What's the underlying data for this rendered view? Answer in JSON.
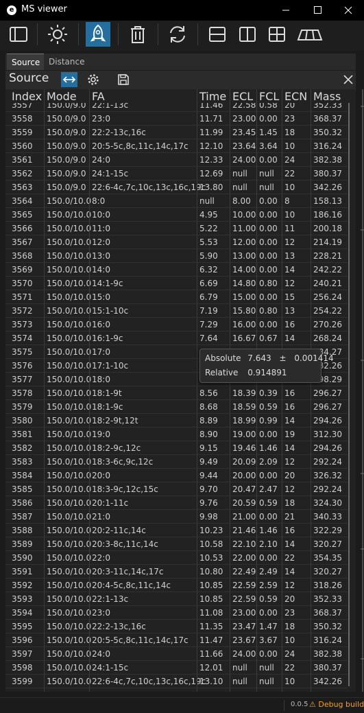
{
  "window": {
    "title": "MS viewer",
    "app_icon_letter": "e"
  },
  "toolbar": {
    "buttons": [
      {
        "name": "sidebar-toggle-button",
        "icon": "sidebar-icon",
        "active": false
      },
      {
        "name": "theme-button",
        "icon": "sun-icon",
        "active": false
      },
      {
        "name": "launch-button",
        "icon": "rocket-icon",
        "active": true
      },
      {
        "name": "delete-button",
        "icon": "trash-icon",
        "active": false
      },
      {
        "name": "refresh-button",
        "icon": "refresh-icon",
        "active": false
      },
      {
        "name": "layout-horizontal-button",
        "icon": "split-horizontal-icon",
        "active": false
      },
      {
        "name": "layout-vertical-button",
        "icon": "split-vertical-icon",
        "active": false
      },
      {
        "name": "layout-grid-button",
        "icon": "grid-icon",
        "active": false
      },
      {
        "name": "layout-perspective-button",
        "icon": "perspective-icon",
        "active": false
      }
    ]
  },
  "tabs": [
    {
      "label": "Source",
      "active": true
    },
    {
      "label": "Distance",
      "active": false
    }
  ],
  "panel": {
    "title": "Source"
  },
  "table": {
    "columns": [
      "Index",
      "Mode",
      "FA",
      "Time",
      "ECL",
      "FCL",
      "ECN",
      "Mass"
    ],
    "rows": [
      [
        "3557",
        "150.0/9.0",
        "22:1-13c",
        "11.46",
        "22.58",
        "0.58",
        "20",
        "352.33"
      ],
      [
        "3558",
        "150.0/9.0",
        "23:0",
        "11.71",
        "23.00",
        "0.00",
        "23",
        "368.37"
      ],
      [
        "3559",
        "150.0/9.0",
        "22:2-13c,16c",
        "11.99",
        "23.45",
        "1.45",
        "18",
        "350.32"
      ],
      [
        "3560",
        "150.0/9.0",
        "20:5-5c,8c,11c,14c,17c",
        "12.10",
        "23.64",
        "3.64",
        "10",
        "316.24"
      ],
      [
        "3561",
        "150.0/9.0",
        "24:0",
        "12.33",
        "24.00",
        "0.00",
        "24",
        "382.38"
      ],
      [
        "3562",
        "150.0/9.0",
        "24:1-15c",
        "12.69",
        "null",
        "null",
        "22",
        "380.37"
      ],
      [
        "3563",
        "150.0/9.0",
        "22:6-4c,7c,10c,13c,16c,19c",
        "13.80",
        "null",
        "null",
        "10",
        "342.26"
      ],
      [
        "3564",
        "150.0/10.0",
        "8:0",
        "null",
        "8.00",
        "0.00",
        "8",
        "158.13"
      ],
      [
        "3565",
        "150.0/10.0",
        "10:0",
        "4.95",
        "10.00",
        "0.00",
        "10",
        "186.16"
      ],
      [
        "3566",
        "150.0/10.0",
        "11:0",
        "5.22",
        "11.00",
        "0.00",
        "11",
        "200.18"
      ],
      [
        "3567",
        "150.0/10.0",
        "12:0",
        "5.53",
        "12.00",
        "0.00",
        "12",
        "214.19"
      ],
      [
        "3568",
        "150.0/10.0",
        "13:0",
        "5.90",
        "13.00",
        "0.00",
        "13",
        "228.21"
      ],
      [
        "3569",
        "150.0/10.0",
        "14:0",
        "6.32",
        "14.00",
        "0.00",
        "14",
        "242.22"
      ],
      [
        "3570",
        "150.0/10.0",
        "14:1-9c",
        "6.69",
        "14.80",
        "0.80",
        "12",
        "240.21"
      ],
      [
        "3571",
        "150.0/10.0",
        "15:0",
        "6.79",
        "15.00",
        "0.00",
        "15",
        "256.24"
      ],
      [
        "3572",
        "150.0/10.0",
        "15:1-10c",
        "7.19",
        "15.80",
        "0.80",
        "13",
        "254.22"
      ],
      [
        "3573",
        "150.0/10.0",
        "16:0",
        "7.29",
        "16.00",
        "0.00",
        "16",
        "270.26"
      ],
      [
        "3574",
        "150.0/10.0",
        "16:1-9c",
        "7.64",
        "16.67",
        "0.67",
        "14",
        "268.24"
      ],
      [
        "3575",
        "150.0/10.0",
        "17:0",
        "",
        "",
        "",
        "",
        "284.27"
      ],
      [
        "3576",
        "150.0/10.0",
        "17:1-10c",
        "",
        "",
        "",
        "",
        "282.26"
      ],
      [
        "3577",
        "150.0/10.0",
        "18:0",
        "",
        "",
        "",
        "",
        "298.29"
      ],
      [
        "3578",
        "150.0/10.0",
        "18:1-9t",
        "8.56",
        "18.39",
        "0.39",
        "16",
        "296.27"
      ],
      [
        "3579",
        "150.0/10.0",
        "18:1-9c",
        "8.68",
        "18.59",
        "0.59",
        "16",
        "296.27"
      ],
      [
        "3580",
        "150.0/10.0",
        "18:2-9t,12t",
        "8.89",
        "18.99",
        "0.99",
        "14",
        "294.26"
      ],
      [
        "3581",
        "150.0/10.0",
        "19:0",
        "8.90",
        "19.00",
        "0.00",
        "19",
        "312.30"
      ],
      [
        "3582",
        "150.0/10.0",
        "18:2-9c,12c",
        "9.15",
        "19.46",
        "1.46",
        "14",
        "294.26"
      ],
      [
        "3583",
        "150.0/10.0",
        "18:3-6c,9c,12c",
        "9.49",
        "20.09",
        "2.09",
        "12",
        "292.24"
      ],
      [
        "3584",
        "150.0/10.0",
        "20:0",
        "9.44",
        "20.00",
        "0.00",
        "20",
        "326.32"
      ],
      [
        "3585",
        "150.0/10.0",
        "18:3-9c,12c,15c",
        "9.70",
        "20.47",
        "2.47",
        "12",
        "292.24"
      ],
      [
        "3586",
        "150.0/10.0",
        "20:1-11c",
        "9.76",
        "20.59",
        "0.59",
        "18",
        "324.30"
      ],
      [
        "3587",
        "150.0/10.0",
        "21:0",
        "9.98",
        "21.00",
        "0.00",
        "21",
        "340.33"
      ],
      [
        "3588",
        "150.0/10.0",
        "20:2-11c,14c",
        "10.23",
        "21.46",
        "1.46",
        "16",
        "322.29"
      ],
      [
        "3589",
        "150.0/10.0",
        "20:3-8c,11c,14c",
        "10.58",
        "22.10",
        "2.10",
        "14",
        "320.27"
      ],
      [
        "3590",
        "150.0/10.0",
        "22:0",
        "10.53",
        "22.00",
        "0.00",
        "22",
        "354.35"
      ],
      [
        "3591",
        "150.0/10.0",
        "20:3-11c,14c,17c",
        "10.80",
        "22.49",
        "2.49",
        "14",
        "320.27"
      ],
      [
        "3592",
        "150.0/10.0",
        "20:4-5c,8c,11c,14c",
        "10.85",
        "22.59",
        "2.59",
        "12",
        "318.26"
      ],
      [
        "3593",
        "150.0/10.0",
        "22:1-13c",
        "10.85",
        "22.59",
        "0.59",
        "20",
        "352.33"
      ],
      [
        "3594",
        "150.0/10.0",
        "23:0",
        "11.08",
        "23.00",
        "0.00",
        "23",
        "368.37"
      ],
      [
        "3595",
        "150.0/10.0",
        "22:2-13c,16c",
        "11.35",
        "23.47",
        "1.47",
        "18",
        "350.32"
      ],
      [
        "3596",
        "150.0/10.0",
        "20:5-5c,8c,11c,14c,17c",
        "11.47",
        "23.67",
        "3.67",
        "10",
        "316.24"
      ],
      [
        "3597",
        "150.0/10.0",
        "24:0",
        "11.66",
        "24.00",
        "0.00",
        "24",
        "382.38"
      ],
      [
        "3598",
        "150.0/10.0",
        "24:1-15c",
        "12.01",
        "null",
        "null",
        "22",
        "380.37"
      ],
      [
        "3599",
        "150.0/10.0",
        "22:6-4c,7c,10c,13c,16c,19c",
        "13.10",
        "null",
        "null",
        "10",
        "342.26"
      ]
    ]
  },
  "tooltip": {
    "absolute_label": "Absolute",
    "absolute_value": "7.643",
    "pm": "±",
    "absolute_error": "0.001414",
    "relative_label": "Relative",
    "relative_value": "0.914891"
  },
  "status": {
    "version": "0.0.5",
    "debug": "⚠ Debug build ⚠"
  },
  "colors": {
    "accent": "#256fa0",
    "warning": "#ff9f1a"
  }
}
